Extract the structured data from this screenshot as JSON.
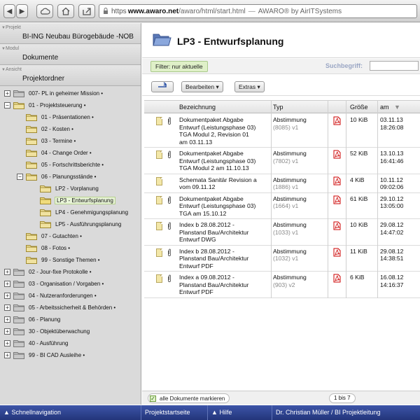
{
  "browser": {
    "nav_back": "◀",
    "nav_forward": "▶",
    "url_scheme": "https",
    "url_domain": "www.awaro.net",
    "url_path": "/awaro/html/start.html",
    "page_title": "AWARO® by AirITSystems"
  },
  "sidebar": {
    "project_caption": "Projekt",
    "project_value": "BI-ING Neubau Bürogebäude -NOB",
    "module_caption": "Modul",
    "module_value": "Dokumente",
    "view_caption": "Ansicht",
    "view_value": "Projektordner",
    "tree": [
      {
        "label": "007- PL in geheimer Mission •",
        "level": 0,
        "toggle": "+",
        "open": false,
        "selected": false
      },
      {
        "label": "01 - Projektsteuerung •",
        "level": 0,
        "toggle": "−",
        "open": true,
        "selected": false
      },
      {
        "label": "01 - Präsentationen •",
        "level": 1,
        "toggle": "",
        "open": false,
        "selected": false
      },
      {
        "label": "02 - Kosten •",
        "level": 1,
        "toggle": "",
        "open": false,
        "selected": false
      },
      {
        "label": "03 - Termine •",
        "level": 1,
        "toggle": "",
        "open": false,
        "selected": false
      },
      {
        "label": "04 - Change Order •",
        "level": 1,
        "toggle": "",
        "open": false,
        "selected": false
      },
      {
        "label": "05 - Fortschrittsberichte •",
        "level": 1,
        "toggle": "",
        "open": false,
        "selected": false
      },
      {
        "label": "06 - Planungsstände •",
        "level": 1,
        "toggle": "−",
        "open": true,
        "selected": false
      },
      {
        "label": "LP2 - Vorplanung",
        "level": 2,
        "toggle": "",
        "open": false,
        "selected": false
      },
      {
        "label": "LP3 - Entwurfsplanung",
        "level": 2,
        "toggle": "",
        "open": true,
        "selected": true
      },
      {
        "label": "LP4 - Genehmigungsplanung",
        "level": 2,
        "toggle": "",
        "open": false,
        "selected": false
      },
      {
        "label": "LP5 - Ausführungsplanung",
        "level": 2,
        "toggle": "",
        "open": false,
        "selected": false
      },
      {
        "label": "07 - Gutachten •",
        "level": 1,
        "toggle": "",
        "open": false,
        "selected": false
      },
      {
        "label": "08 - Fotos •",
        "level": 1,
        "toggle": "",
        "open": false,
        "selected": false
      },
      {
        "label": "99 - Sonstige Themen •",
        "level": 1,
        "toggle": "",
        "open": false,
        "selected": false
      },
      {
        "label": "02 - Jour-fixe Protokolle •",
        "level": 0,
        "toggle": "+",
        "open": false,
        "selected": false
      },
      {
        "label": "03 - Organisation / Vorgaben •",
        "level": 0,
        "toggle": "+",
        "open": false,
        "selected": false
      },
      {
        "label": "04 - Nutzeranforderungen •",
        "level": 0,
        "toggle": "+",
        "open": false,
        "selected": false
      },
      {
        "label": "05 - Arbeitssicherheit & Behörden •",
        "level": 0,
        "toggle": "+",
        "open": false,
        "selected": false
      },
      {
        "label": "06 - Planung",
        "level": 0,
        "toggle": "+",
        "open": false,
        "selected": false
      },
      {
        "label": "30 - Objektüberwachung",
        "level": 0,
        "toggle": "+",
        "open": false,
        "selected": false
      },
      {
        "label": "40 - Ausführung",
        "level": 0,
        "toggle": "+",
        "open": false,
        "selected": false
      },
      {
        "label": "99 - BI CAD Ausleihe •",
        "level": 0,
        "toggle": "+",
        "open": false,
        "selected": false
      }
    ]
  },
  "main": {
    "title": "LP3 - Entwurfsplanung",
    "filter_label": "Filter: nur aktuelle",
    "search_label": "Suchbegriff:",
    "search_value": "",
    "toolbar": {
      "up_icon": "up-arrow-icon",
      "edit_label": "Bearbeiten",
      "extras_label": "Extras"
    },
    "columns": {
      "name": "Bezeichnung",
      "type": "Typ",
      "size": "Größe",
      "date": "am"
    },
    "rows": [
      {
        "name": [
          "Dokumentpaket Abgabe",
          "Entwurf (Leistungsphase 03)",
          "TGA Modul 2, Revision 01",
          "am 03.11.13"
        ],
        "attach": true,
        "type": "Abstimmung",
        "ver": "(8085) v1",
        "size": "10 KiB",
        "date": "03.11.13",
        "time": "18:26:08"
      },
      {
        "name": [
          "Dokumentpaket Abgabe",
          "Entwurf (Leistungsphase 03)",
          "TGA Modul 2 am 11.10.13"
        ],
        "attach": true,
        "type": "Abstimmung",
        "ver": "(7802) v1",
        "size": "52 KiB",
        "date": "13.10.13",
        "time": "16:41:46"
      },
      {
        "name": [
          "Schemata Sanitär Revision a",
          "vom 09.11.12"
        ],
        "attach": false,
        "type": "Abstimmung",
        "ver": "(1886) v1",
        "size": "4 KiB",
        "date": "10.11.12",
        "time": "09:02:06"
      },
      {
        "name": [
          "Dokumentpaket Abgabe",
          "Entwurf (Leistungsphase 03)",
          "TGA am 15.10.12"
        ],
        "attach": true,
        "type": "Abstimmung",
        "ver": "(1664) v1",
        "size": "61 KiB",
        "date": "29.10.12",
        "time": "13:05:00"
      },
      {
        "name": [
          "Index b 28.08.2012 -",
          "Planstand Bau/Architektur",
          "Entwurf DWG"
        ],
        "attach": true,
        "type": "Abstimmung",
        "ver": "(1033) v1",
        "size": "10 KiB",
        "date": "29.08.12",
        "time": "14:47:02"
      },
      {
        "name": [
          "Index b 28.08.2012 -",
          "Planstand Bau/Architektur",
          "Entwurf PDF"
        ],
        "attach": true,
        "type": "Abstimmung",
        "ver": "(1032) v1",
        "size": "11 KiB",
        "date": "29.08.12",
        "time": "14:38:51"
      },
      {
        "name": [
          "Index a 09.08.2012 -",
          "Planstand Bau/Architektur",
          "Entwurf PDF"
        ],
        "attach": true,
        "type": "Abstimmung",
        "ver": "(903) v2",
        "size": "6 KiB",
        "date": "16.08.12",
        "time": "14:16:37"
      }
    ],
    "mark_all_label": "alle Dokumente markieren",
    "page_info": "1 bis 7"
  },
  "footer": {
    "quicknav": "Schnellnavigation",
    "project_home": "Projektstartseite",
    "help": "Hilfe",
    "user": "Dr. Christian Müller / BI Projektleitung"
  },
  "colors": {
    "footer_bg": "#2c3f8c",
    "selection_green": "#dff0c8",
    "pdf_red": "#cc0000"
  }
}
